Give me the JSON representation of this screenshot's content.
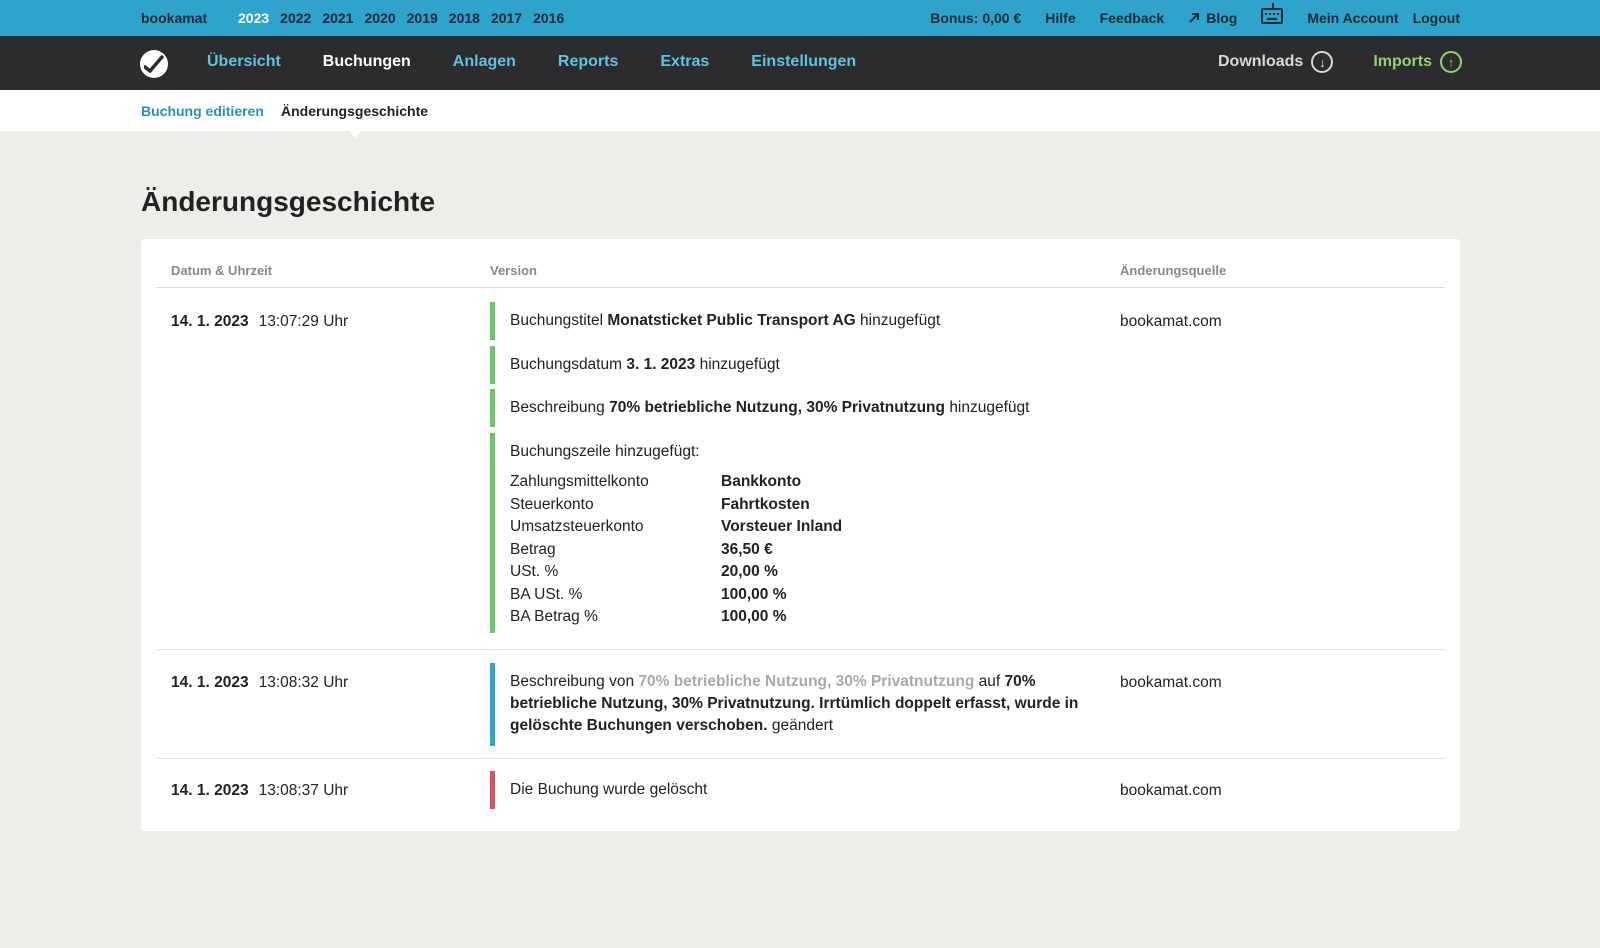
{
  "topbar": {
    "brand": "bookamat",
    "years": [
      "2023",
      "2022",
      "2021",
      "2020",
      "2019",
      "2018",
      "2017",
      "2016"
    ],
    "bonus": "Bonus: 0,00 €",
    "help": "Hilfe",
    "feedback": "Feedback",
    "blog": "Blog",
    "account": "Mein Account",
    "logout": "Logout"
  },
  "nav": {
    "items": [
      "Übersicht",
      "Buchungen",
      "Anlagen",
      "Reports",
      "Extras",
      "Einstellungen"
    ],
    "active": "Buchungen",
    "downloads": "Downloads",
    "imports": "Imports"
  },
  "subnav": {
    "edit": "Buchung editieren",
    "history": "Änderungsgeschichte"
  },
  "page_title": "Änderungsgeschichte",
  "table": {
    "headers": {
      "date": "Datum & Uhrzeit",
      "version": "Version",
      "source": "Änderungsquelle"
    },
    "rows": [
      {
        "date": "14. 1. 2023",
        "time": "13:07:29 Uhr",
        "source": "bookamat.com",
        "entries": [
          {
            "pre": "Buchungstitel",
            "bold": "Monatsticket Public Transport AG",
            "post": "hinzugefügt"
          },
          {
            "pre": "Buchungsdatum",
            "bold": "3. 1. 2023",
            "post": "hinzugefügt"
          },
          {
            "pre": "Beschreibung",
            "bold": "70% betriebliche Nutzung, 30% Privatnutzung",
            "post": "hinzugefügt"
          }
        ],
        "line": {
          "title": "Buchungszeile hinzugefügt:",
          "fields": [
            {
              "label": "Zahlungsmittelkonto",
              "value": "Bankkonto"
            },
            {
              "label": "Steuerkonto",
              "value": "Fahrtkosten"
            },
            {
              "label": "Umsatzsteuerkonto",
              "value": "Vorsteuer Inland"
            },
            {
              "label": "Betrag",
              "value": "36,50 €"
            },
            {
              "label": "USt. %",
              "value": "20,00 %"
            },
            {
              "label": "BA USt. %",
              "value": "100,00 %"
            },
            {
              "label": "BA Betrag %",
              "value": "100,00 %"
            }
          ]
        }
      },
      {
        "date": "14. 1. 2023",
        "time": "13:08:32 Uhr",
        "source": "bookamat.com",
        "change": {
          "pre": "Beschreibung von",
          "old": "70% betriebliche Nutzung, 30% Privatnutzung",
          "mid": "auf",
          "new": "70% betriebliche Nutzung, 30% Privatnutzung. Irrtümlich doppelt erfasst, wurde in gelöschte Buchungen verschoben.",
          "post": "geändert"
        }
      },
      {
        "date": "14. 1. 2023",
        "time": "13:08:37 Uhr",
        "source": "bookamat.com",
        "text": "Die Buchung wurde gelöscht"
      }
    ]
  }
}
